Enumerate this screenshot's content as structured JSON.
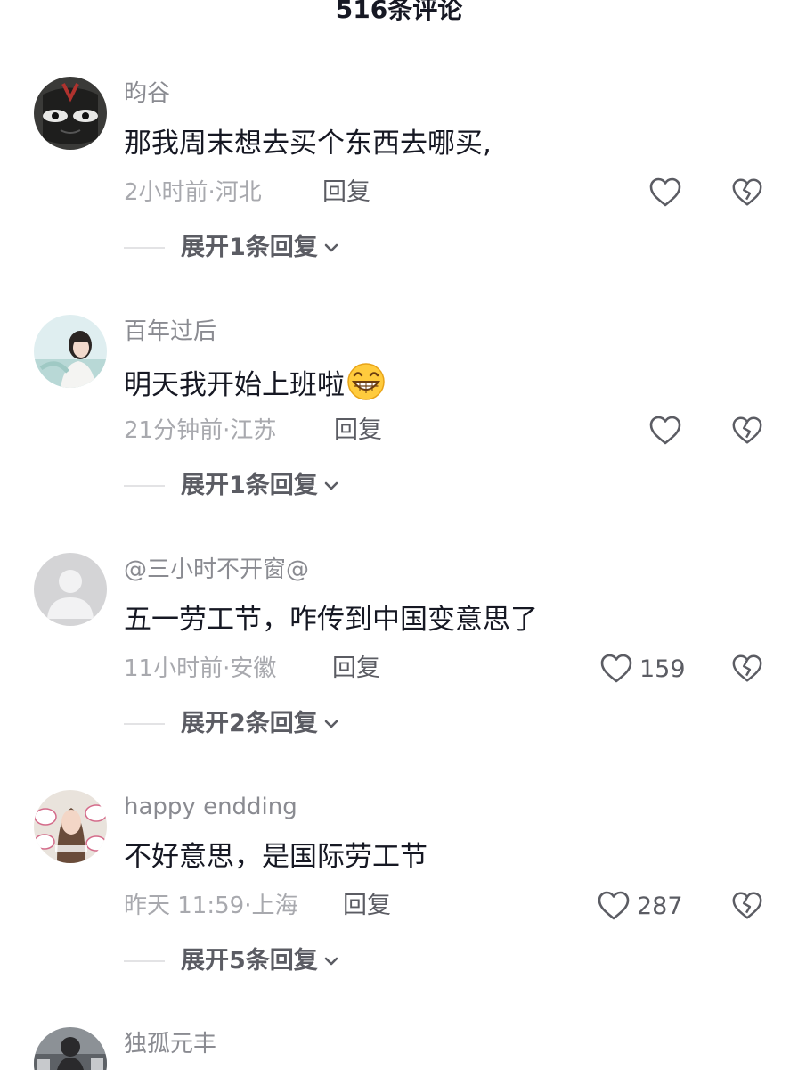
{
  "header": {
    "title": "516条评论"
  },
  "comments": [
    {
      "username": "昀谷",
      "text": "那我周末想去买个东西去哪买,",
      "meta": "2小时前·河北",
      "reply_label": "回复",
      "like_count": "",
      "expand_label": "展开1条回复",
      "avatar_icon": "masked-face-avatar"
    },
    {
      "username": "百年过后",
      "text": "明天我开始上班啦",
      "emoji": "grinning-face-emoji",
      "meta": "21分钟前·江苏",
      "reply_label": "回复",
      "like_count": "",
      "expand_label": "展开1条回复",
      "avatar_icon": "girl-portrait-avatar"
    },
    {
      "username": "@三小时不开窗@",
      "text": "五一劳工节，咋传到中国变意思了",
      "meta": "11小时前·安徽",
      "reply_label": "回复",
      "like_count": "159",
      "expand_label": "展开2条回复",
      "avatar_icon": "default-user-avatar"
    },
    {
      "username": "happy endding",
      "text": "不好意思，是国际劳工节",
      "meta": "昨天 11:59·上海",
      "reply_label": "回复",
      "like_count": "287",
      "expand_label": "展开5条回复",
      "avatar_icon": "photo-collage-avatar"
    },
    {
      "username": "独孤元丰",
      "avatar_icon": "photo-avatar"
    }
  ],
  "colors": {
    "primary_text": "#161823",
    "secondary_text": "#8a8b91",
    "meta_text": "#a8a9ae",
    "action_text": "#5b5c63",
    "divider": "#e3e3e5"
  }
}
